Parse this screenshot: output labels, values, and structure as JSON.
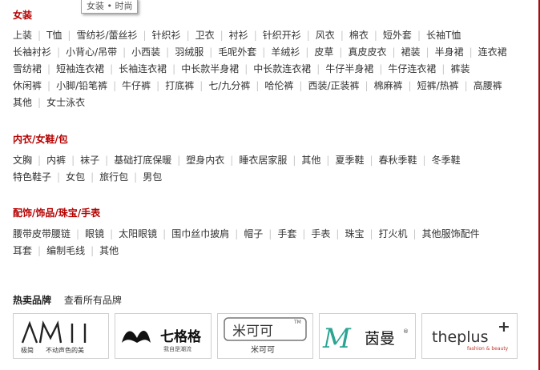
{
  "tooltip": "女装 • 时尚",
  "sections": [
    {
      "title": "女装",
      "rows": [
        [
          "上装",
          "T恤",
          "雪纺衫/蕾丝衫",
          "针织衫",
          "卫衣",
          "衬衫",
          "针织开衫",
          "风衣",
          "棉衣",
          "短外套",
          "长袖T恤"
        ],
        [
          "长袖衬衫",
          "小背心/吊带",
          "小西装",
          "羽绒服",
          "毛呢外套",
          "羊绒衫",
          "皮草",
          "真皮皮衣",
          "裙装",
          "半身裙",
          "连衣裙"
        ],
        [
          "雪纺裙",
          "短袖连衣裙",
          "长袖连衣裙",
          "中长款半身裙",
          "中长款连衣裙",
          "牛仔半身裙",
          "牛仔连衣裙",
          "裤装"
        ],
        [
          "休闲裤",
          "小脚/铅笔裤",
          "牛仔裤",
          "打底裤",
          "七/九分裤",
          "哈伦裤",
          "西装/正装裤",
          "棉麻裤",
          "短裤/热裤",
          "高腰裤"
        ],
        [
          "其他",
          "女士泳衣"
        ]
      ]
    },
    {
      "title": "内衣/女鞋/包",
      "rows": [
        [
          "文胸",
          "内裤",
          "袜子",
          "基础打底保暖",
          "塑身内衣",
          "睡衣居家服",
          "其他",
          "夏季鞋",
          "春秋季鞋",
          "冬季鞋"
        ],
        [
          "特色鞋子",
          "女包",
          "旅行包",
          "男包"
        ]
      ]
    },
    {
      "title": "配饰/饰品/珠宝/手表",
      "rows": [
        [
          "腰带皮带腰链",
          "眼镜",
          "太阳眼镜",
          "围巾丝巾披肩",
          "帽子",
          "手套",
          "手表",
          "珠宝",
          "打火机",
          "其他服饰配件"
        ],
        [
          "耳套",
          "编制毛线",
          "其他"
        ]
      ]
    }
  ],
  "brands": {
    "title": "热卖品牌",
    "all_link": "查看所有品牌",
    "items": [
      {
        "name": "AMII",
        "tag1": "极简",
        "tag2": "不动声色的美"
      },
      {
        "name": "七格格",
        "tag": "我自是潮流"
      },
      {
        "name": "米可可",
        "tm": "TM",
        "sub": "米可可"
      },
      {
        "name": "茵曼",
        "letter": "M",
        "reg": "®"
      },
      {
        "name": "theplus",
        "plus": "+",
        "tag": "fashion & beauty"
      }
    ]
  }
}
